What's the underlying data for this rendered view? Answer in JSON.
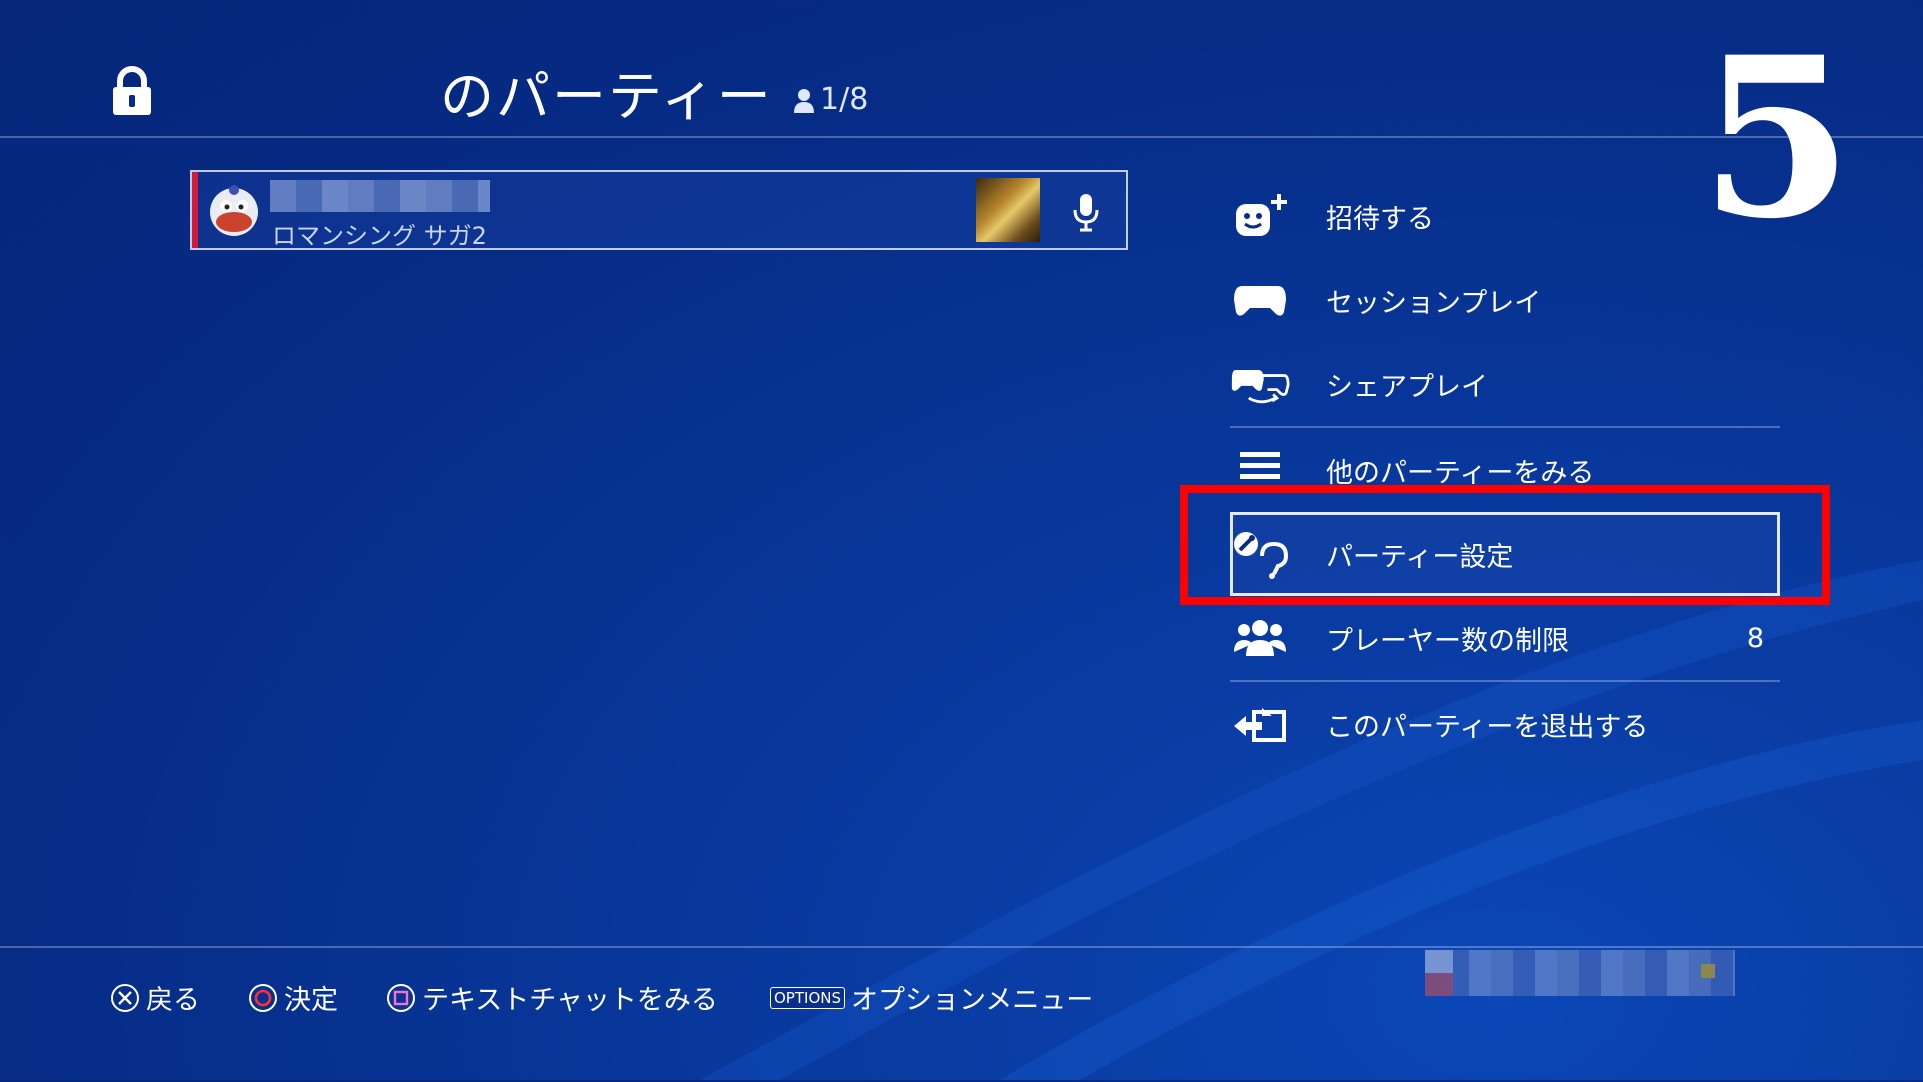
{
  "party": {
    "title": "のパーティー",
    "member_count": "1/8"
  },
  "step_number": "5",
  "member": {
    "game_title": "ロマンシング サガ2"
  },
  "menu": {
    "invite": "招待する",
    "session_play": "セッションプレイ",
    "share_play": "シェアプレイ",
    "view_other_parties": "他のパーティーをみる",
    "party_settings": "パーティー設定",
    "player_limit": "プレーヤー数の制限",
    "player_limit_value": "8",
    "leave_party": "このパーティーを退出する"
  },
  "hints": {
    "back": "戻る",
    "confirm": "決定",
    "text_chat": "テキストチャットをみる",
    "options_key": "OPTIONS",
    "options_menu": "オプションメニュー"
  },
  "colors": {
    "background": "#062c86",
    "highlight": "#ff0000",
    "member_accent": "#d61a3c"
  }
}
